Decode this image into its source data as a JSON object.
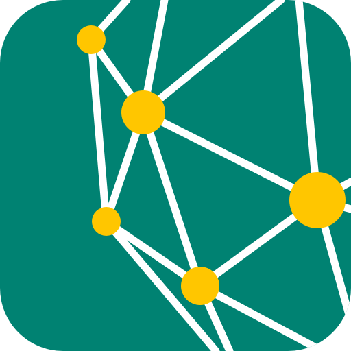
{
  "icon": {
    "name": "network-graph-app-icon",
    "colors": {
      "background": "#ffffff",
      "tile": "#008272",
      "edge": "#ffffff",
      "node": "#ffc600"
    }
  }
}
